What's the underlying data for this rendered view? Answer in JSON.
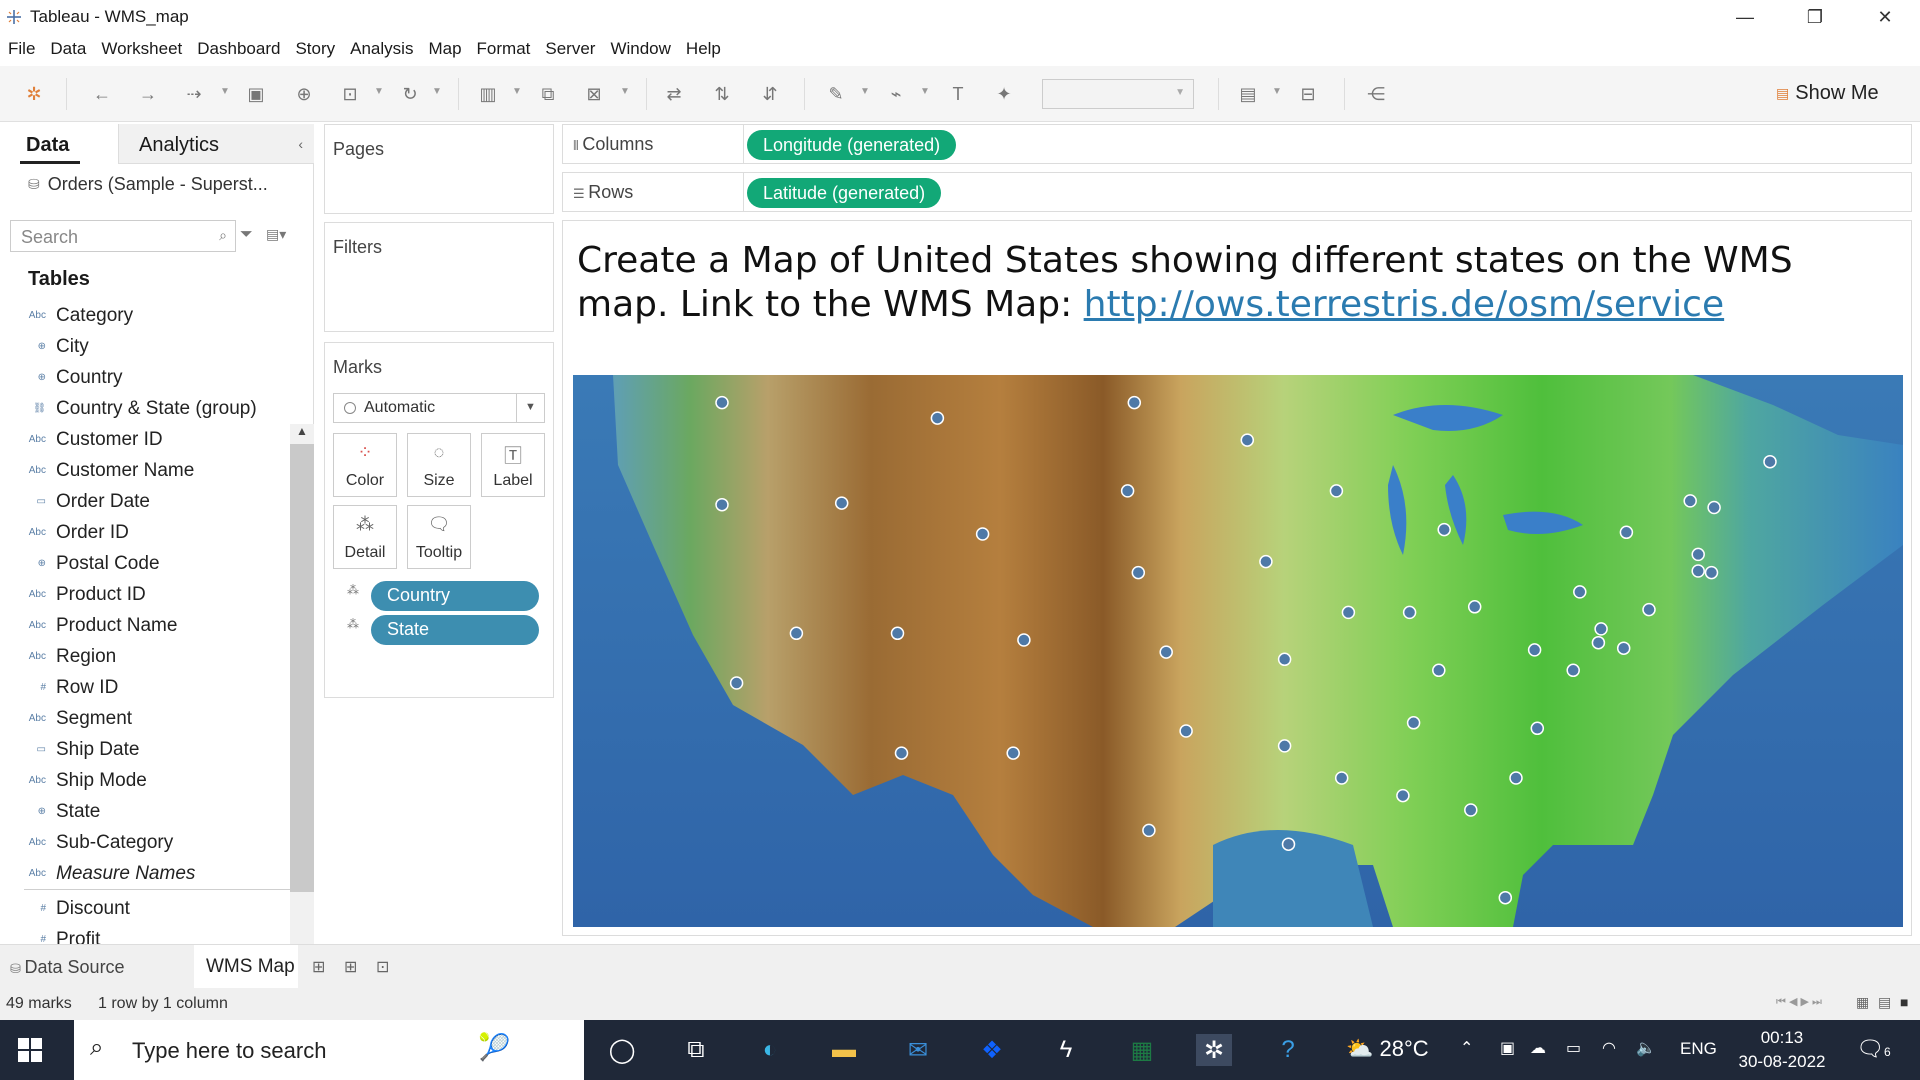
{
  "window": {
    "title": "Tableau - WMS_map",
    "minimize_icon": "minimize-icon",
    "restore_icon": "restore-icon",
    "close_icon": "close-icon"
  },
  "menu": [
    "File",
    "Data",
    "Worksheet",
    "Dashboard",
    "Story",
    "Analysis",
    "Map",
    "Format",
    "Server",
    "Window",
    "Help"
  ],
  "toolbar": {
    "show_me_label": "Show Me"
  },
  "data_pane": {
    "tab_data": "Data",
    "tab_analytics": "Analytics",
    "datasource": "Orders (Sample - Superst...",
    "search_placeholder": "Search",
    "tables_heading": "Tables",
    "fields": [
      {
        "type": "Abc",
        "name": "Category"
      },
      {
        "type": "globe",
        "name": "City"
      },
      {
        "type": "globe",
        "name": "Country"
      },
      {
        "type": "group",
        "name": "Country & State (group)"
      },
      {
        "type": "Abc",
        "name": "Customer ID"
      },
      {
        "type": "Abc",
        "name": "Customer Name"
      },
      {
        "type": "date",
        "name": "Order Date"
      },
      {
        "type": "Abc",
        "name": "Order ID"
      },
      {
        "type": "globe",
        "name": "Postal Code"
      },
      {
        "type": "Abc",
        "name": "Product ID"
      },
      {
        "type": "Abc",
        "name": "Product Name"
      },
      {
        "type": "Abc",
        "name": "Region"
      },
      {
        "type": "#",
        "name": "Row ID"
      },
      {
        "type": "Abc",
        "name": "Segment"
      },
      {
        "type": "date",
        "name": "Ship Date"
      },
      {
        "type": "Abc",
        "name": "Ship Mode"
      },
      {
        "type": "globe",
        "name": "State"
      },
      {
        "type": "Abc",
        "name": "Sub-Category"
      },
      {
        "type": "Abc",
        "name": "Measure Names",
        "italic": true
      },
      {
        "type": "#",
        "name": "Discount"
      },
      {
        "type": "#",
        "name": "Profit"
      }
    ]
  },
  "shelves": {
    "pages": "Pages",
    "filters": "Filters",
    "marks": "Marks",
    "mark_type": "Automatic",
    "mark_buttons": [
      "Color",
      "Size",
      "Label",
      "Detail",
      "Tooltip"
    ],
    "mark_pills": [
      "Country",
      "State"
    ],
    "columns_label": "Columns",
    "rows_label": "Rows",
    "columns_pill": "Longitude (generated)",
    "rows_pill": "Latitude (generated)"
  },
  "view": {
    "title_text": "Create a Map of United States showing different states on the WMS map. Link to the WMS Map: ",
    "link": "http://ows.terrestris.de/osm/service",
    "marks_color": "#4e79a7",
    "points": [
      [
        0.112,
        0.05
      ],
      [
        0.274,
        0.078
      ],
      [
        0.422,
        0.05
      ],
      [
        0.507,
        0.118
      ],
      [
        0.417,
        0.21
      ],
      [
        0.574,
        0.21
      ],
      [
        0.112,
        0.235
      ],
      [
        0.202,
        0.232
      ],
      [
        0.308,
        0.288
      ],
      [
        0.425,
        0.358
      ],
      [
        0.521,
        0.338
      ],
      [
        0.655,
        0.28
      ],
      [
        0.9,
        0.157
      ],
      [
        0.84,
        0.228
      ],
      [
        0.858,
        0.24
      ],
      [
        0.792,
        0.285
      ],
      [
        0.846,
        0.325
      ],
      [
        0.846,
        0.355
      ],
      [
        0.856,
        0.358
      ],
      [
        0.583,
        0.43
      ],
      [
        0.629,
        0.43
      ],
      [
        0.678,
        0.42
      ],
      [
        0.757,
        0.393
      ],
      [
        0.809,
        0.425
      ],
      [
        0.773,
        0.46
      ],
      [
        0.771,
        0.485
      ],
      [
        0.79,
        0.495
      ],
      [
        0.168,
        0.468
      ],
      [
        0.244,
        0.468
      ],
      [
        0.339,
        0.48
      ],
      [
        0.446,
        0.502
      ],
      [
        0.535,
        0.515
      ],
      [
        0.723,
        0.498
      ],
      [
        0.651,
        0.535
      ],
      [
        0.752,
        0.535
      ],
      [
        0.123,
        0.558
      ],
      [
        0.461,
        0.645
      ],
      [
        0.535,
        0.672
      ],
      [
        0.632,
        0.63
      ],
      [
        0.725,
        0.64
      ],
      [
        0.247,
        0.685
      ],
      [
        0.331,
        0.685
      ],
      [
        0.578,
        0.73
      ],
      [
        0.624,
        0.762
      ],
      [
        0.709,
        0.73
      ],
      [
        0.675,
        0.788
      ],
      [
        0.433,
        0.825
      ],
      [
        0.538,
        0.85
      ],
      [
        0.701,
        0.947
      ]
    ]
  },
  "sheets": {
    "datasource_tab": "Data Source",
    "active_sheet": "WMS Map"
  },
  "status": {
    "marks": "49 marks",
    "layout": "1 row by 1 column"
  },
  "taskbar": {
    "search_placeholder": "Type here to search",
    "temperature": "28°C",
    "language": "ENG",
    "time": "00:13",
    "date": "30-08-2022",
    "notifications": "6"
  }
}
